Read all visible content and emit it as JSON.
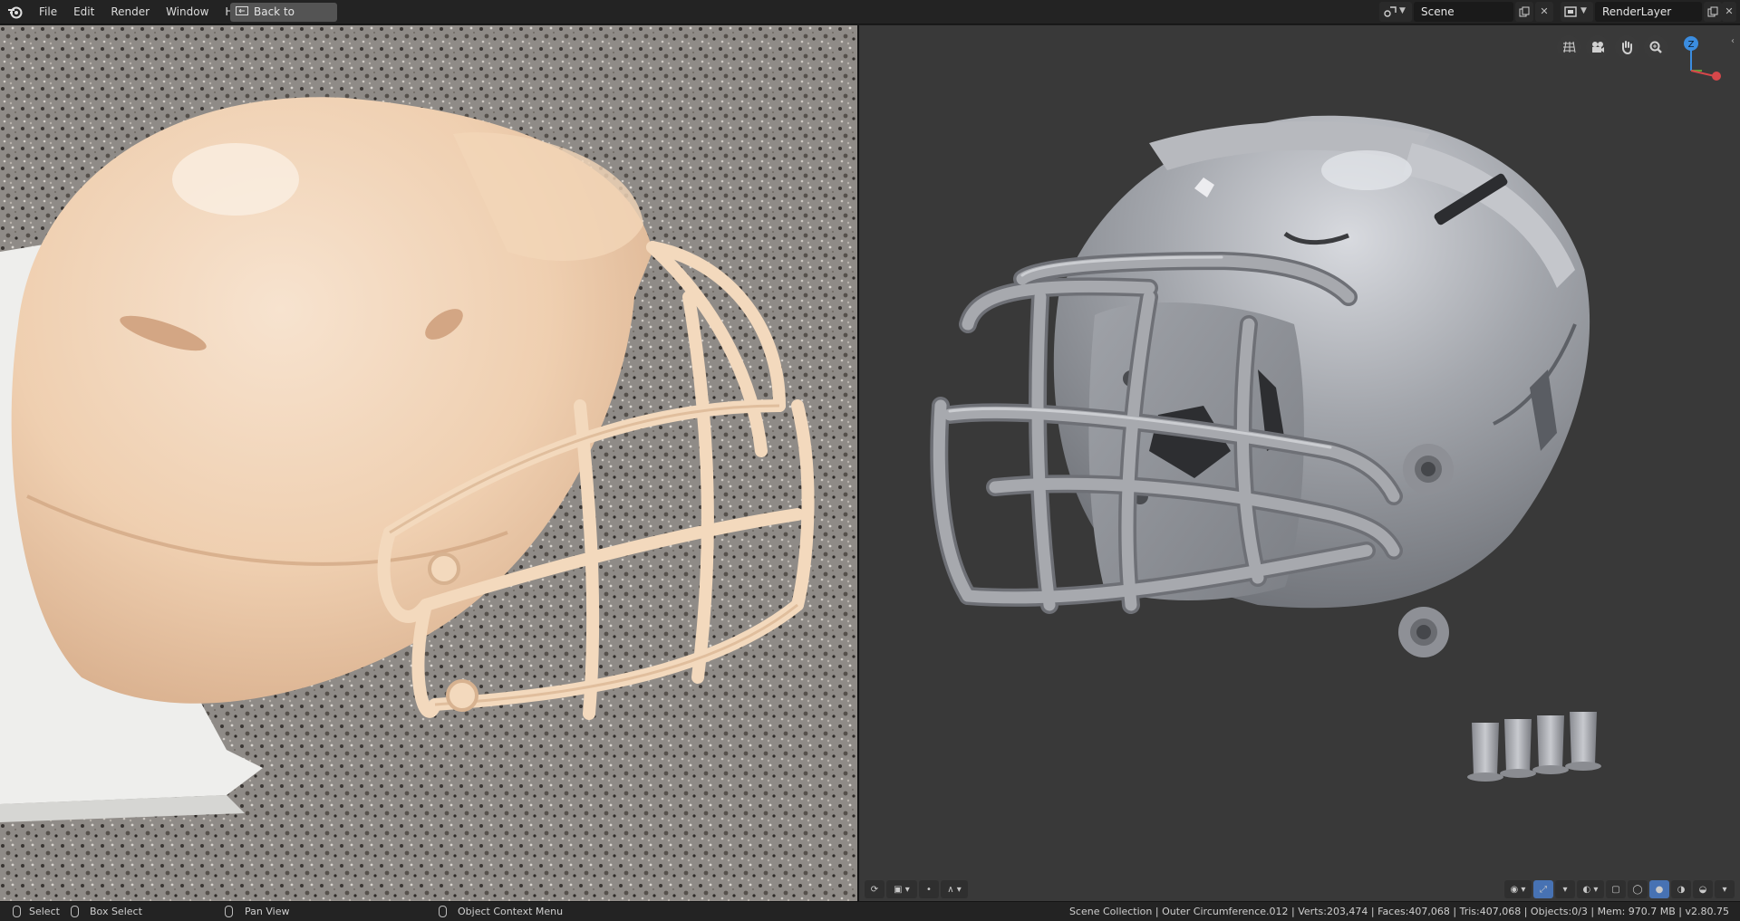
{
  "menu": [
    "File",
    "Edit",
    "Render",
    "Window",
    "Help"
  ],
  "back_button": "Back to Previous",
  "scene": {
    "name": "Scene",
    "icon": "scene-icon"
  },
  "render_layer": {
    "name": "RenderLayer",
    "icon": "render-layer-icon"
  },
  "gizmo_axis": "Z",
  "status": {
    "left_items": [
      {
        "label": "Select",
        "icon": "mouse-left-icon"
      },
      {
        "label": "Box Select",
        "icon": "mouse-drag-icon"
      },
      {
        "label": "Pan View",
        "icon": "mouse-middle-icon"
      },
      {
        "label": "Object Context Menu",
        "icon": "mouse-right-icon"
      }
    ],
    "stats": "Scene Collection | Outer Circumference.012 | Verts:203,474 | Faces:407,068 | Tris:407,068 | Objects:0/3 | Mem: 970.7 MB | v2.80.75"
  },
  "colors": {
    "accent": "#4772b3",
    "viewport_bg": "#393939",
    "topbar_bg": "#232323",
    "helmet_resin": "#f1d2b5",
    "helmet_model": "#9a9ca2"
  }
}
